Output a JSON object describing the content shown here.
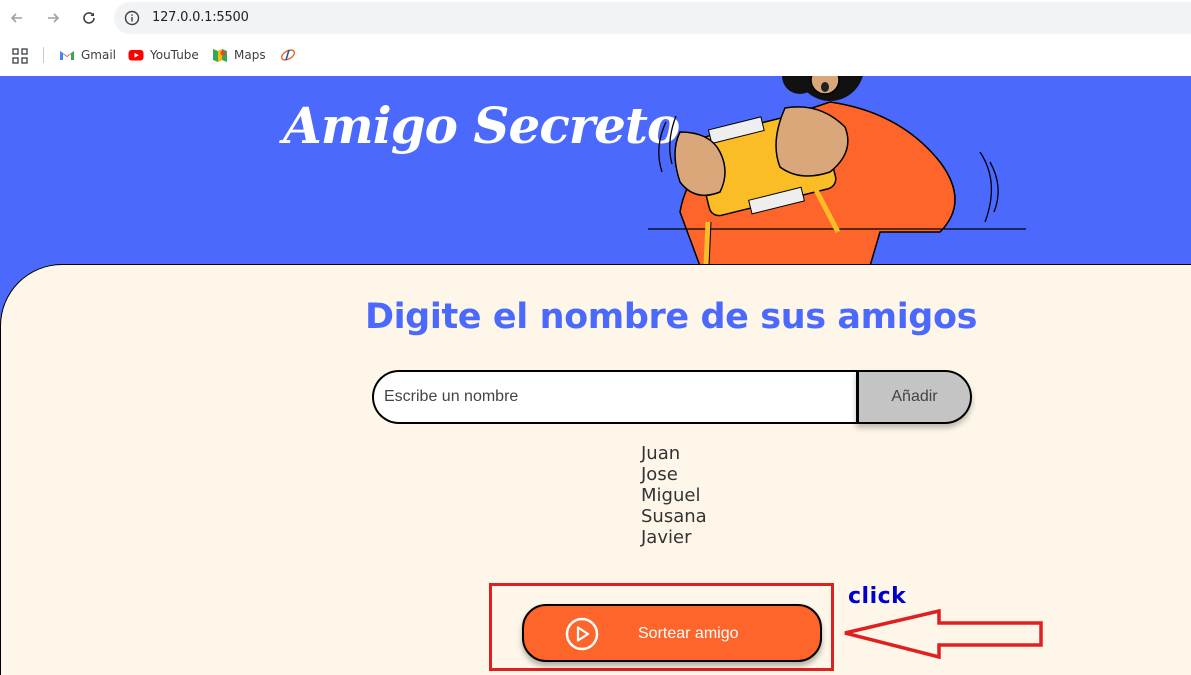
{
  "browser": {
    "url": "127.0.0.1:5500",
    "bookmarks": [
      {
        "label": "Gmail"
      },
      {
        "label": "YouTube"
      },
      {
        "label": "Maps"
      }
    ]
  },
  "banner": {
    "title": "Amigo Secreto"
  },
  "main": {
    "heading": "Digite el nombre de sus amigos",
    "input_placeholder": "Escribe un nombre",
    "add_label": "Añadir",
    "friends": [
      "Juan",
      "Jose",
      "Miguel",
      "Susana",
      "Javier"
    ],
    "draw_label": "Sortear amigo"
  },
  "annotation": {
    "label": "click"
  },
  "colors": {
    "banner": "#4b69fd",
    "background": "#fef7e9",
    "accent": "#fe652b",
    "annotation_box": "#e02020",
    "annotation_text": "#0000cc"
  }
}
